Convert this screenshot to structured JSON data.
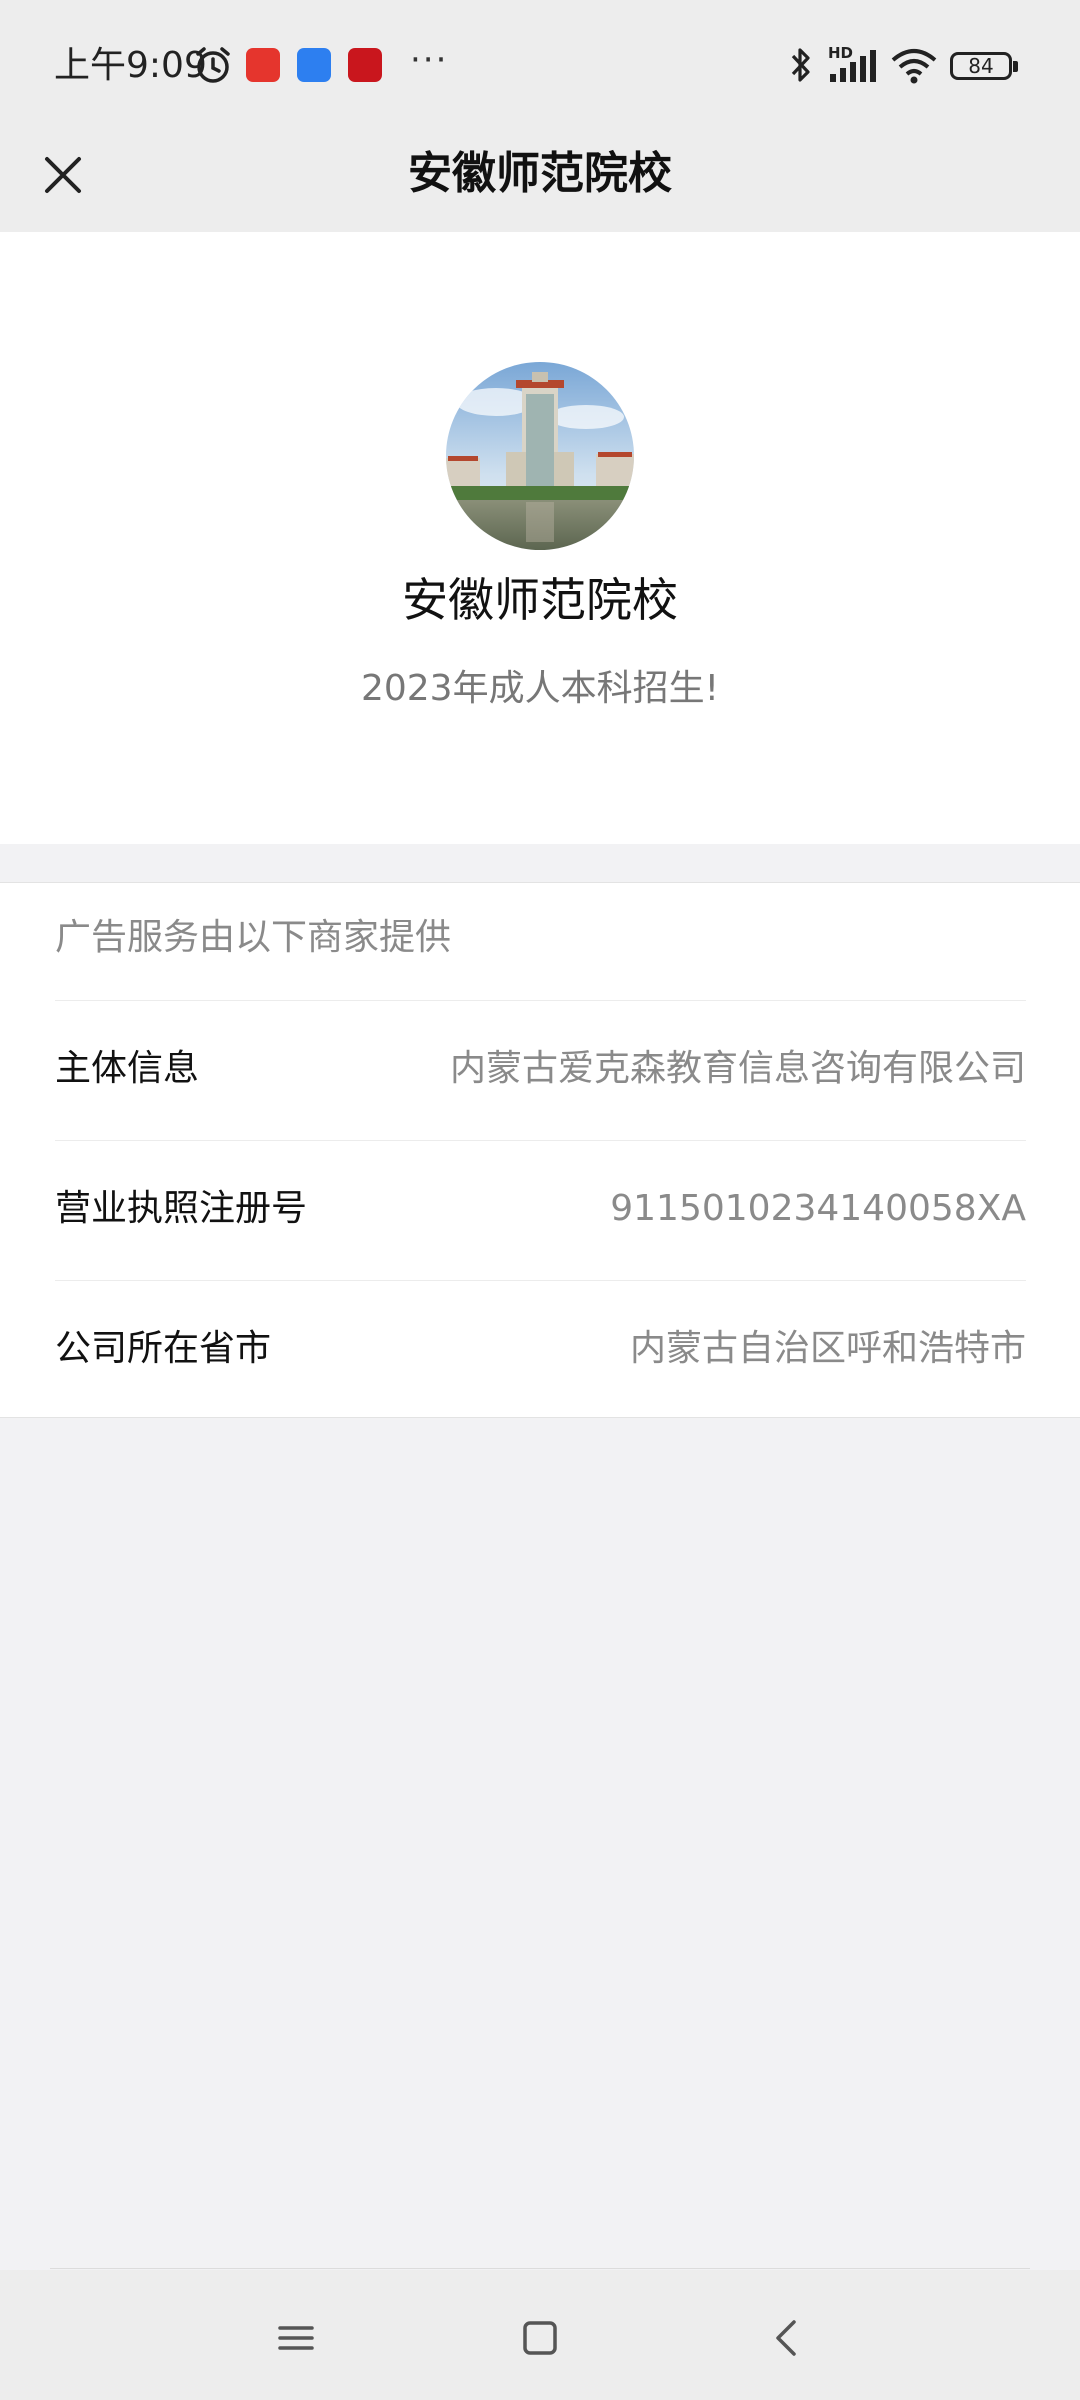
{
  "status_bar": {
    "time": "上午9:09",
    "battery_level": "84",
    "network_label": "HD",
    "icons": [
      "alarm-icon",
      "app-notification-icon",
      "app-notification-icon",
      "app-notification-icon",
      "more-icon",
      "bluetooth-icon",
      "signal-icon",
      "wifi-icon",
      "battery-icon"
    ],
    "more": "···"
  },
  "header": {
    "title": "安徽师范院校",
    "close_icon": "close-icon"
  },
  "profile": {
    "avatar_icon": "building-photo-icon",
    "name": "安徽师范院校",
    "slogan": "2023年成人本科招生!"
  },
  "advertiser_info": {
    "section_title": "广告服务由以下商家提供",
    "rows": [
      {
        "label": "主体信息",
        "value": "内蒙古爱克森教育信息咨询有限公司"
      },
      {
        "label": "营业执照注册号",
        "value": "9115010234140058XA"
      },
      {
        "label": "公司所在省市",
        "value": "内蒙古自治区呼和浩特市"
      }
    ]
  },
  "system_nav": {
    "icons": [
      "menu-icon",
      "home-icon",
      "back-icon"
    ]
  },
  "colors": {
    "bar_bg": "#ededed",
    "page_bg": "#f2f2f4",
    "card_bg": "#ffffff",
    "secondary_text": "#8a8a8a"
  }
}
